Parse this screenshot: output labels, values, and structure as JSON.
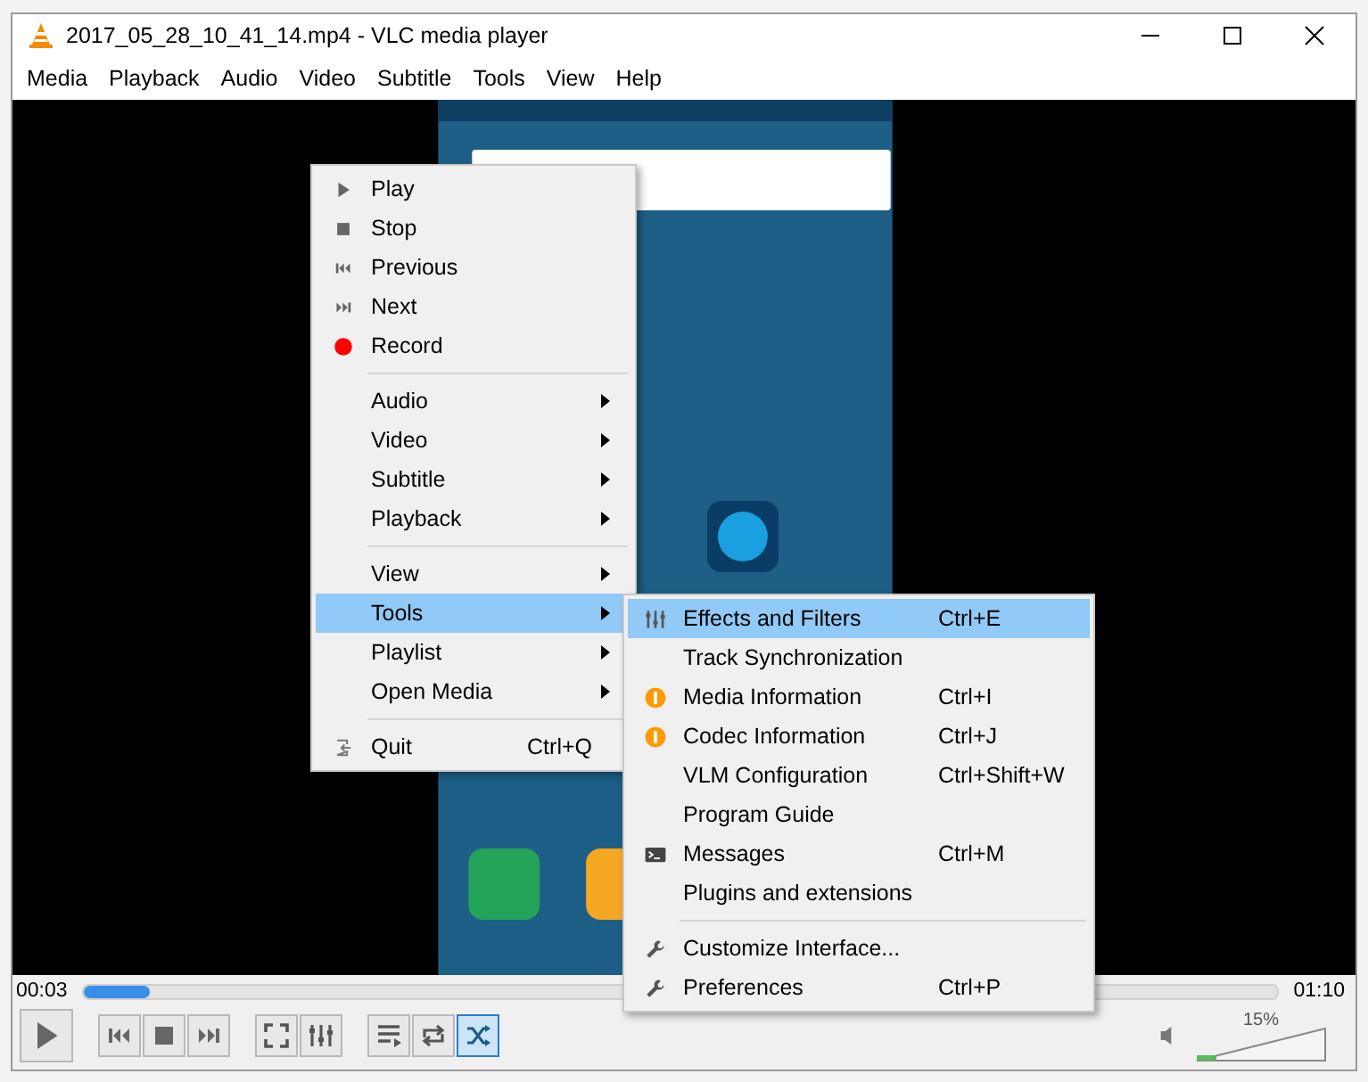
{
  "window": {
    "title": "2017_05_28_10_41_14.mp4 - VLC media player"
  },
  "menu_bar": [
    "Media",
    "Playback",
    "Audio",
    "Video",
    "Subtitle",
    "Tools",
    "View",
    "Help"
  ],
  "video": {
    "kind": "picture"
  },
  "context_menu": {
    "groups": [
      [
        {
          "label": "Play",
          "kind": "play",
          "submenu": false,
          "selected": false
        },
        {
          "label": "Stop",
          "kind": "stop",
          "submenu": false,
          "selected": false
        },
        {
          "label": "Previous",
          "kind": "previous",
          "submenu": false,
          "selected": false
        },
        {
          "label": "Next",
          "kind": "next",
          "submenu": false,
          "selected": false
        },
        {
          "label": "Record",
          "kind": "record",
          "submenu": false,
          "selected": false
        }
      ],
      [
        {
          "label": "Audio",
          "kind": "plain",
          "submenu": true,
          "selected": false
        },
        {
          "label": "Video",
          "kind": "plain",
          "submenu": true,
          "selected": false
        },
        {
          "label": "Subtitle",
          "kind": "plain",
          "submenu": true,
          "selected": false
        },
        {
          "label": "Playback",
          "kind": "plain",
          "submenu": true,
          "selected": false
        }
      ],
      [
        {
          "label": "View",
          "kind": "plain",
          "submenu": true,
          "selected": false
        },
        {
          "label": "Tools",
          "kind": "plain",
          "submenu": true,
          "selected": true
        },
        {
          "label": "Playlist",
          "kind": "plain",
          "submenu": true,
          "selected": false
        },
        {
          "label": "Open Media",
          "kind": "plain",
          "submenu": true,
          "selected": false
        }
      ],
      [
        {
          "label": "Quit",
          "kind": "quit",
          "submenu": false,
          "selected": false,
          "shortcut": "Ctrl+Q"
        }
      ]
    ]
  },
  "tools_submenu": {
    "groups": [
      [
        {
          "label": "Effects and Filters",
          "kind": "sliders",
          "shortcut": "Ctrl+E",
          "selected": true
        },
        {
          "label": "Track Synchronization",
          "kind": "plain",
          "selected": false
        },
        {
          "label": "Media Information",
          "kind": "info",
          "shortcut": "Ctrl+I",
          "selected": false
        },
        {
          "label": "Codec Information",
          "kind": "info",
          "shortcut": "Ctrl+J",
          "selected": false
        },
        {
          "label": "VLM Configuration",
          "kind": "plain",
          "shortcut": "Ctrl+Shift+W",
          "selected": false
        },
        {
          "label": "Program Guide",
          "kind": "plain",
          "selected": false
        },
        {
          "label": "Messages",
          "kind": "terminal",
          "shortcut": "Ctrl+M",
          "selected": false
        },
        {
          "label": "Plugins and extensions",
          "kind": "plain",
          "selected": false
        }
      ],
      [
        {
          "label": "Customize Interface...",
          "kind": "wrench",
          "selected": false
        },
        {
          "label": "Preferences",
          "kind": "wrench",
          "shortcut": "Ctrl+P",
          "selected": false
        }
      ]
    ]
  },
  "seek": {
    "elapsed": "00:03",
    "total": "01:10",
    "level": 0.055
  },
  "toolbar_groups": [
    [
      {
        "kind": "play",
        "selected": false
      }
    ],
    [
      {
        "kind": "previous",
        "selected": false
      },
      {
        "kind": "stop",
        "selected": false
      },
      {
        "kind": "next",
        "selected": false
      }
    ],
    [
      {
        "kind": "fullscreen",
        "selected": false
      },
      {
        "kind": "sliders",
        "selected": false
      }
    ],
    [
      {
        "kind": "playlist",
        "selected": false
      },
      {
        "kind": "loop",
        "selected": false
      },
      {
        "kind": "shuffle",
        "selected": true
      }
    ]
  ],
  "volume": {
    "reading": "15%",
    "level": 0.15
  }
}
